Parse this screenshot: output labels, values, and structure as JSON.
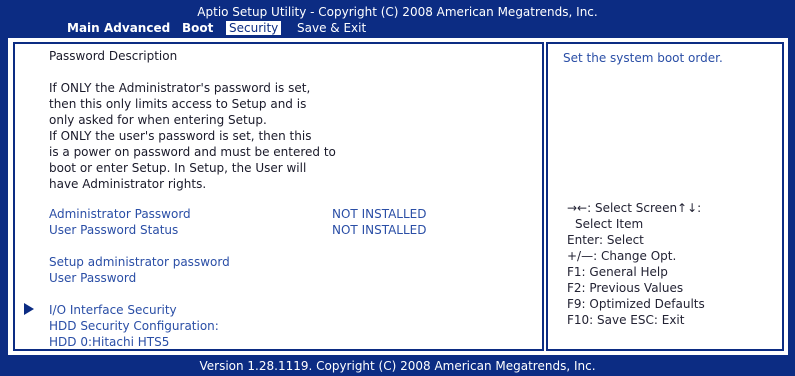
{
  "header": {
    "title": "Aptio Setup Utility - Copyright (C) 2008 American Megatrends, Inc."
  },
  "menu": {
    "main": "Main",
    "advanced": "Advanced",
    "boot": "Boot",
    "security": "Security",
    "save_exit": "Save & Exit",
    "active": "Security"
  },
  "description": {
    "heading": "Password Description",
    "lines": [
      "If ONLY the Administrator's password is set,",
      "then this only limits access to Setup and is",
      "only asked for when entering Setup.",
      "If ONLY the user's password is set, then this",
      "is a power on password and must be entered to",
      "boot or enter Setup. In Setup, the User will",
      "have Administrator rights."
    ]
  },
  "status": {
    "admin_label": "Administrator Password",
    "admin_value": "NOT INSTALLED",
    "user_label": "User Password Status",
    "user_value": "NOT INSTALLED"
  },
  "items": {
    "setup_admin": "Setup administrator password",
    "user_password": "User Password",
    "io_security": "I/O Interface Security",
    "hdd_security": "HDD Security Configuration:",
    "hdd0": "HDD 0:Hitachi HTS5"
  },
  "help": {
    "text": "Set the system boot order.",
    "keys": [
      "→←: Select Screen↑↓:",
      "Select Item",
      "Enter: Select",
      "+/—: Change Opt.",
      "F1:     General Help",
      "F2:     Previous Values",
      "F9:     Optimized Defaults",
      "F10:  Save   ESC: Exit"
    ]
  },
  "footer": {
    "version": "Version 1.28.1119. Copyright (C) 2008 American Megatrends, Inc."
  },
  "colors": {
    "bios_blue": "#0c2c83",
    "panel_bg": "#ffffff",
    "item_blue": "#2a4ea6"
  }
}
